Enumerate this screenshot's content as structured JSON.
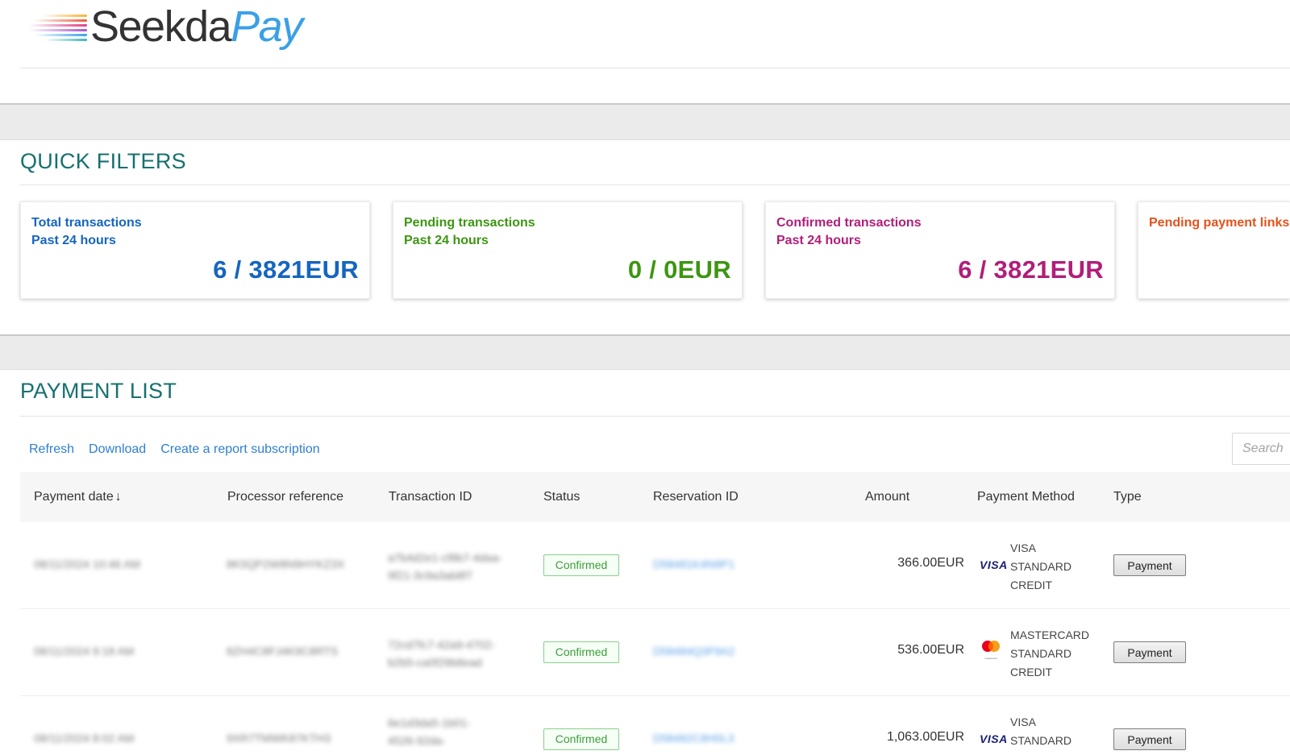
{
  "brand": {
    "name_part1": "Seekda",
    "name_part2": "Pay",
    "stripe_colors": [
      "#f5b335",
      "#ee5b3e",
      "#e03e86",
      "#a855c7",
      "#3aa0e6",
      "#3cb6b0"
    ]
  },
  "quick_filters": {
    "title": "QUICK FILTERS",
    "cards": [
      {
        "title_line1": "Total transactions",
        "title_line2": "Past 24 hours",
        "value": "6 / 3821EUR",
        "color": "#1565c0"
      },
      {
        "title_line1": "Pending transactions",
        "title_line2": "Past 24 hours",
        "value": "0 / 0EUR",
        "color": "#3d9612"
      },
      {
        "title_line1": "Confirmed transactions",
        "title_line2": "Past 24 hours",
        "value": "6 / 3821EUR",
        "color": "#b01e79"
      },
      {
        "title_line1": "Pending payment links",
        "title_line2": "",
        "value": "",
        "color": "#e5521c"
      }
    ]
  },
  "payment_list": {
    "title": "PAYMENT LIST",
    "actions": {
      "refresh": "Refresh",
      "download": "Download",
      "subscription": "Create a report subscription"
    },
    "search_placeholder": "Search",
    "columns": {
      "payment_date": "Payment date",
      "sort_indicator": "↓",
      "processor_reference": "Processor reference",
      "transaction_id": "Transaction ID",
      "status": "Status",
      "reservation_id": "Reservation ID",
      "amount": "Amount",
      "payment_method": "Payment Method",
      "type": "Type"
    },
    "rows": [
      {
        "payment_date": "08/11/2024 10:46 AM",
        "processor_reference": "8K5QP2W8N9HYKZ3X",
        "transaction_id_1": "a7b4d2e1-cf8b7-4daa-",
        "transaction_id_2": "9f21-3c9a3ab8f7",
        "status": "Confirmed",
        "reservation_id": "D58481K4N9P1",
        "amount": "366.00EUR",
        "pm_icon": "visa-icon",
        "pm_icon_text": "VISA",
        "pm_line1": "VISA",
        "pm_line2": "STANDARD",
        "pm_line3": "CREDIT",
        "type": "Payment"
      },
      {
        "payment_date": "08/11/2024 9:18 AM",
        "processor_reference": "8ZH4C8FJ4K9C8RTS",
        "transaction_id_1": "72cd7fc7-42a9-4702-",
        "transaction_id_2": "b2b5-ca0f29b8ead",
        "status": "Confirmed",
        "reservation_id": "D58484Q3F9A2",
        "amount": "536.00EUR",
        "pm_icon": "mastercard-icon",
        "pm_icon_text": "mastercard",
        "pm_line1": "MASTERCARD",
        "pm_line2": "STANDARD",
        "pm_line3": "CREDIT",
        "type": "Payment"
      },
      {
        "payment_date": "08/11/2024 8:02 AM",
        "processor_reference": "9XR7TMWK87KTH3",
        "transaction_id_1": "6e1d3da5-1b01-",
        "transaction_id_2": "4526-92da-",
        "status": "Confirmed",
        "reservation_id": "D58482C8H0L3",
        "amount": "1,063.00EUR",
        "pm_icon": "visa-icon",
        "pm_icon_text": "VISA",
        "pm_line1": "VISA",
        "pm_line2": "STANDARD",
        "pm_line3": "",
        "type": "Payment"
      }
    ]
  }
}
